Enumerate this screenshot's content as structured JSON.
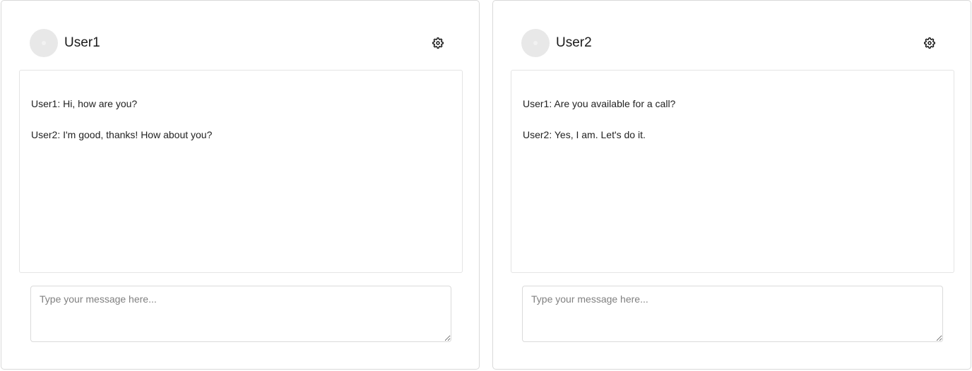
{
  "panels": [
    {
      "user_name": "User1",
      "avatar_icon": "user-avatar-placeholder",
      "settings_icon": "gear-icon",
      "messages": [
        "User1: Hi, how are you?",
        "User2: I'm good, thanks! How about you?"
      ],
      "input_placeholder": "Type your message here...",
      "input_value": ""
    },
    {
      "user_name": "User2",
      "avatar_icon": "user-avatar-placeholder",
      "settings_icon": "gear-icon",
      "messages": [
        "User1: Are you available for a call?",
        "User2: Yes, I am. Let's do it."
      ],
      "input_placeholder": "Type your message here...",
      "input_value": ""
    }
  ],
  "colors": {
    "border": "#d9d9d9",
    "avatar_bg": "#e8e8e8",
    "text": "#222222",
    "placeholder": "#808080"
  }
}
